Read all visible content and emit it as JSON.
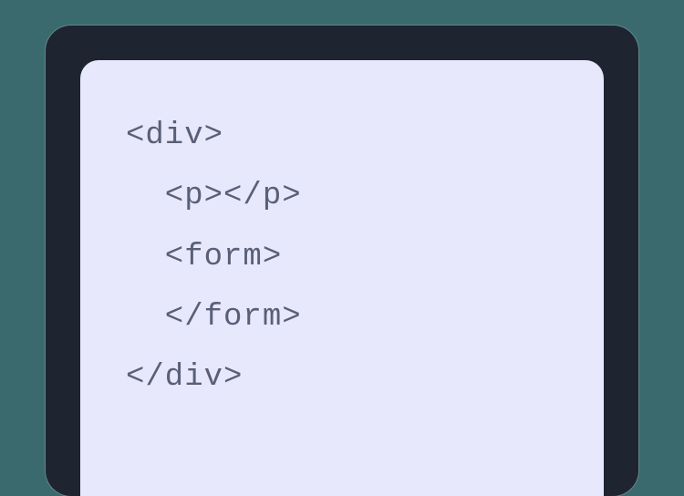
{
  "code": {
    "lines": [
      "<div>",
      "  <p></p>",
      "  <form>",
      "  </form>",
      "</div>"
    ]
  }
}
